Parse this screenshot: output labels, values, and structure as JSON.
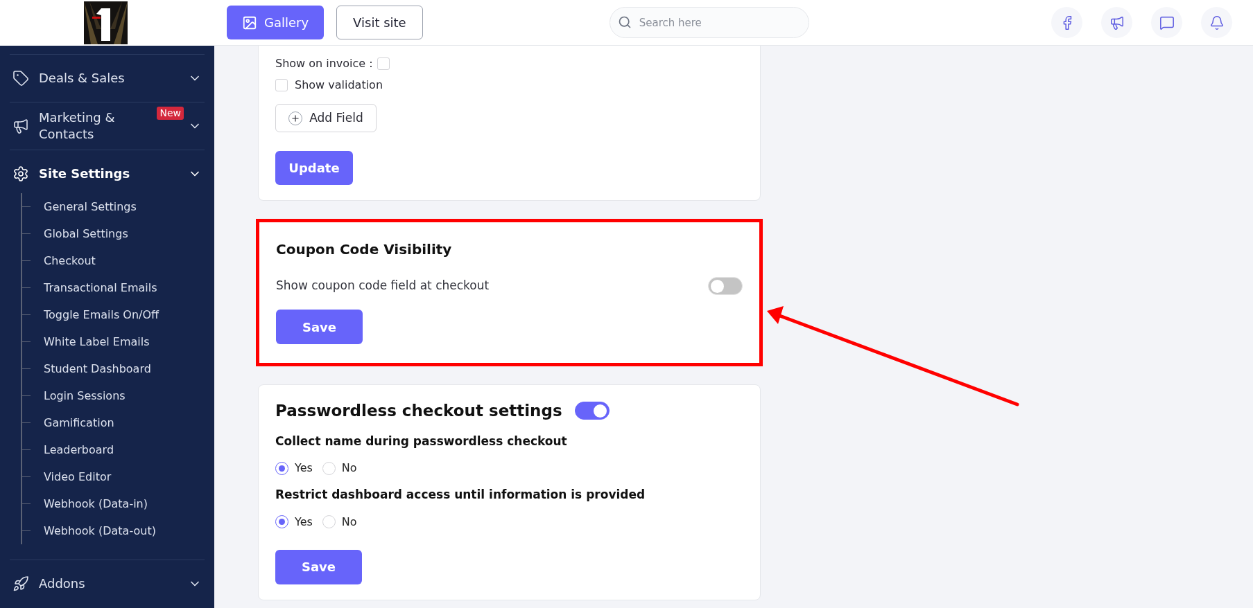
{
  "header": {
    "buttons": [
      {
        "label": "Gallery",
        "kind": "primary"
      },
      {
        "label": "Visit site",
        "kind": "outline"
      }
    ],
    "search": {
      "placeholder": "Search here"
    }
  },
  "sidebar": {
    "items": [
      {
        "label": "Deals & Sales",
        "expanded": false
      },
      {
        "label": "Marketing & Contacts",
        "badge": "New",
        "expanded": false
      },
      {
        "label": "Site Settings",
        "expanded": true,
        "children": [
          {
            "label": "General Settings"
          },
          {
            "label": "Global Settings"
          },
          {
            "label": "Checkout"
          },
          {
            "label": "Transactional Emails"
          },
          {
            "label": "Toggle Emails On/Off"
          },
          {
            "label": "White Label Emails"
          },
          {
            "label": "Student Dashboard"
          },
          {
            "label": "Login Sessions"
          },
          {
            "label": "Gamification"
          },
          {
            "label": "Leaderboard"
          },
          {
            "label": "Video Editor"
          },
          {
            "label": "Webhook (Data-in)"
          },
          {
            "label": "Webhook (Data-out)"
          }
        ]
      },
      {
        "label": "Addons",
        "expanded": false
      }
    ]
  },
  "fields_card": {
    "invoice_checkbox": {
      "label": "Show on invoice :",
      "checked": false
    },
    "validation_checkbox": {
      "label": "Show validation",
      "checked": false
    },
    "add_button": "Add Field",
    "submit_button": "Update"
  },
  "coupon_card": {
    "title": "Coupon Code Visibility",
    "highlighted": true,
    "toggle": {
      "label": "Show coupon code field at checkout",
      "on": false
    },
    "save_button": "Save"
  },
  "passwordless_card": {
    "title": "Passwordless checkout settings",
    "on": true,
    "questions": [
      {
        "label": "Collect name during passwordless checkout",
        "options": [
          {
            "label": "Yes",
            "selected": true
          },
          {
            "label": "No",
            "selected": false
          }
        ]
      },
      {
        "label": "Restrict dashboard access until information is provided",
        "options": [
          {
            "label": "Yes",
            "selected": true
          },
          {
            "label": "No",
            "selected": false
          }
        ]
      }
    ],
    "save_button": "Save"
  }
}
